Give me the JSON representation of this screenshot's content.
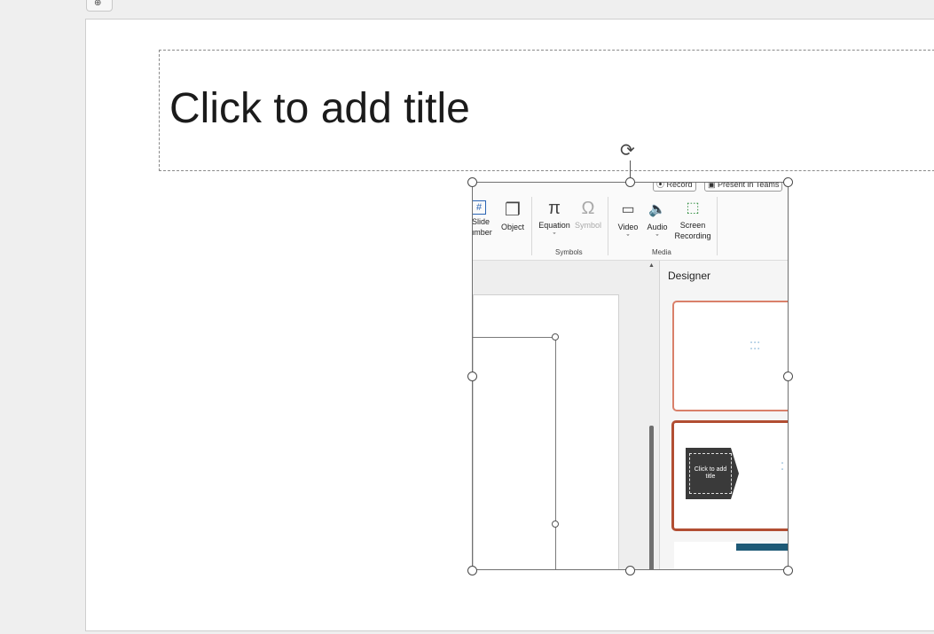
{
  "window": {
    "corner_icon": "picture-style-icon"
  },
  "slide": {
    "title_placeholder": "Click to add title"
  },
  "picture": {
    "ribbon": {
      "top_buttons": [
        {
          "label": "⦿ Record",
          "icon": "record-icon"
        },
        {
          "label": "▣ Present in Teams",
          "icon": "teams-icon"
        }
      ],
      "items": [
        {
          "line1": "Slide",
          "line2": "umber",
          "icon": "slide-number-icon",
          "enabled": true
        },
        {
          "line1": "Object",
          "line2": "",
          "icon": "object-icon",
          "enabled": true
        },
        {
          "line1": "Equation",
          "line2": "ˇ",
          "icon": "pi-icon",
          "enabled": true
        },
        {
          "line1": "Symbol",
          "line2": "",
          "icon": "omega-icon",
          "enabled": false
        },
        {
          "line1": "Video",
          "line2": "ˇ",
          "icon": "video-icon",
          "enabled": true
        },
        {
          "line1": "Audio",
          "line2": "ˇ",
          "icon": "audio-icon",
          "enabled": true
        },
        {
          "line1": "Screen",
          "line2": "Recording",
          "icon": "screen-recording-icon",
          "enabled": true
        }
      ],
      "groups": {
        "symbols": "Symbols",
        "media": "Media"
      }
    },
    "designer": {
      "header": "Designer",
      "card2_title": "Click to add title"
    }
  },
  "colors": {
    "accent_orange": "#d9806a",
    "accent_dark_red": "#b24e33",
    "teal_bar": "#1e5a77"
  }
}
